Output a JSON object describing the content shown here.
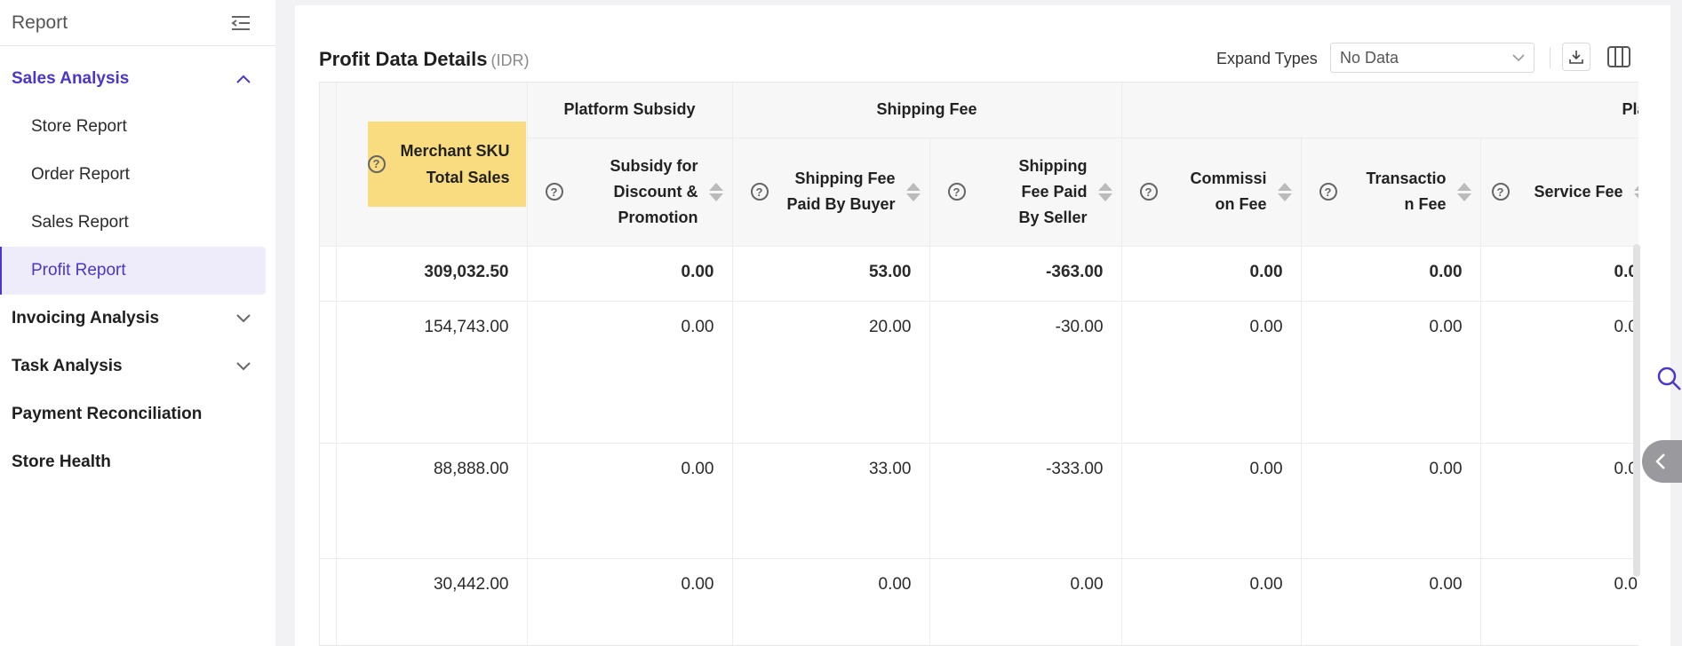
{
  "sidebar": {
    "title": "Report",
    "groups": [
      {
        "label": "Sales Analysis",
        "expanded": true
      },
      {
        "label": "Invoicing Analysis",
        "expanded": false
      },
      {
        "label": "Task Analysis",
        "expanded": false
      },
      {
        "label": "Payment Reconciliation"
      },
      {
        "label": "Store Health"
      }
    ],
    "sales_items": [
      "Store Report",
      "Order Report",
      "Sales Report",
      "Profit Report"
    ],
    "selected_item": "Profit Report"
  },
  "header": {
    "title": "Profit Data Details",
    "unit": "(IDR)",
    "expand_types_label": "Expand Types",
    "expand_types_value": "No Data"
  },
  "table": {
    "group_headers": [
      "Platform Subsidy",
      "Shipping Fee",
      "Platf"
    ],
    "columns": [
      "Merchant SKU Total Sales",
      "Subsidy for Discount & Promotion",
      "Shipping Fee Paid By Buyer",
      "Shipping Fee Paid By Seller",
      "Commission Fee",
      "Transaction Fee",
      "Service Fee"
    ],
    "rows": [
      [
        "309,032.50",
        "0.00",
        "53.00",
        "-363.00",
        "0.00",
        "0.00",
        "0.0"
      ],
      [
        "154,743.00",
        "0.00",
        "20.00",
        "-30.00",
        "0.00",
        "0.00",
        "0.0"
      ],
      [
        "88,888.00",
        "0.00",
        "33.00",
        "-333.00",
        "0.00",
        "0.00",
        "0.0"
      ],
      [
        "30,442.00",
        "0.00",
        "0.00",
        "0.00",
        "0.00",
        "0.00",
        "0.0"
      ]
    ]
  },
  "colors": {
    "accent": "#4a37c9",
    "highlight": "#f9dc80",
    "selected_bg": "#eeecfb"
  },
  "icons": [
    "collapse-menu-icon",
    "chevron-up-icon",
    "chevron-down-icon",
    "help-icon",
    "sort-icon",
    "download-icon",
    "columns-icon",
    "search-icon",
    "chevron-left-icon"
  ]
}
